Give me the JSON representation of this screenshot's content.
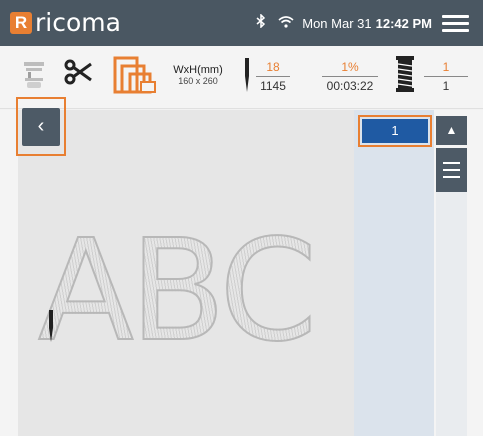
{
  "brand": {
    "logo_mark": "R",
    "name": "ricoma"
  },
  "status_bar": {
    "date": "Mon Mar 31",
    "time": "12:42 PM"
  },
  "toolbar": {
    "size": {
      "label": "WxH(mm)",
      "value": "160 x 260"
    },
    "stitches": {
      "current": "18",
      "total": "1145"
    },
    "progress": {
      "percent": "1%",
      "time": "00:03:22"
    },
    "thread": {
      "current": "1",
      "total": "1"
    }
  },
  "design": {
    "text": "ABC"
  },
  "color_list": {
    "selected_index": "1",
    "selected_color": "#1f5aa3"
  },
  "icons": {
    "back": "chevron-left-icon",
    "scroll_up": "triangle-up-icon",
    "list": "list-icon",
    "menu": "hamburger-menu-icon"
  },
  "colors": {
    "accent": "#e87f32",
    "bar": "#4a5762",
    "button": "#4d5a66"
  }
}
